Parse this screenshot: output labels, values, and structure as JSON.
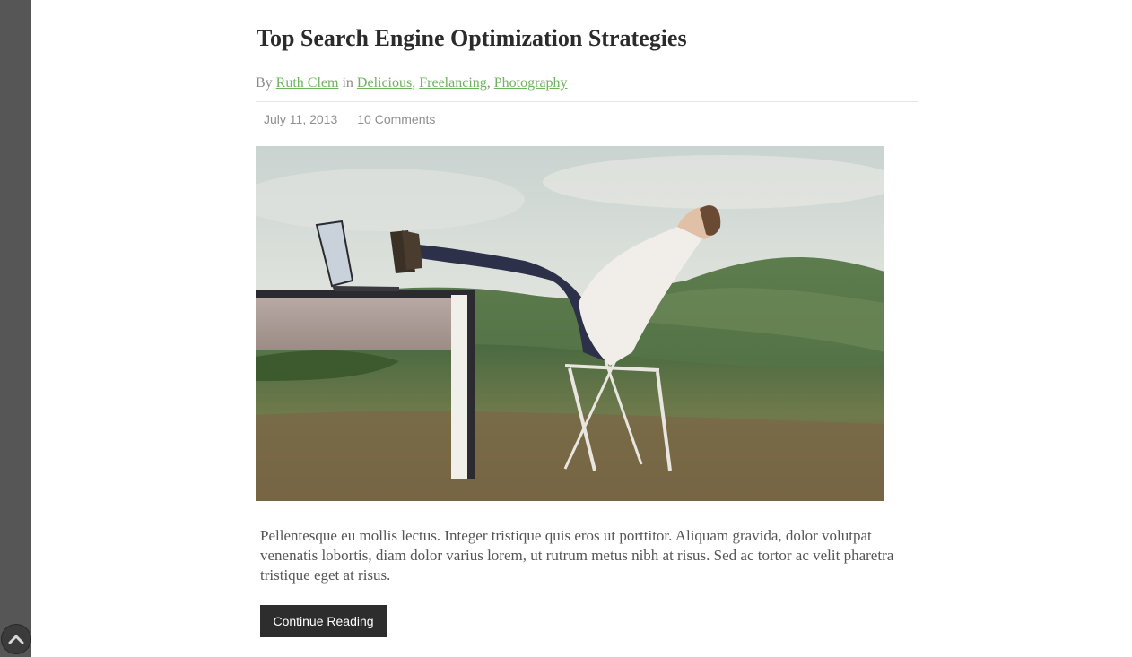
{
  "post": {
    "title": "Top Search Engine Optimization Strategies",
    "byline": {
      "by_text": "By",
      "author": "Ruth Clem",
      "in_text": "in",
      "categories": [
        "Delicious",
        "Freelancing",
        "Photography"
      ],
      "separator": ","
    },
    "meta": {
      "date": "July 11, 2013",
      "comments": "10 Comments"
    },
    "featured_image": {
      "icon": "featured-image-man-relaxing-at-desk-in-field"
    },
    "excerpt": "Pellentesque eu mollis lectus. Integer tristique quis eros ut porttitor. Aliquam gravida, dolor volutpat venenatis lobortis, diam dolor varius lorem, ut rutrum metus nibh at risus. Sed ac tortor ac velit pharetra tristique eget at risus.",
    "continue_label": "Continue Reading"
  },
  "ui": {
    "scroll_top_icon": "chevron-up-icon",
    "link_color": "#6db35c",
    "sidebar_color": "#565656",
    "button_color": "#2d2d2d"
  }
}
